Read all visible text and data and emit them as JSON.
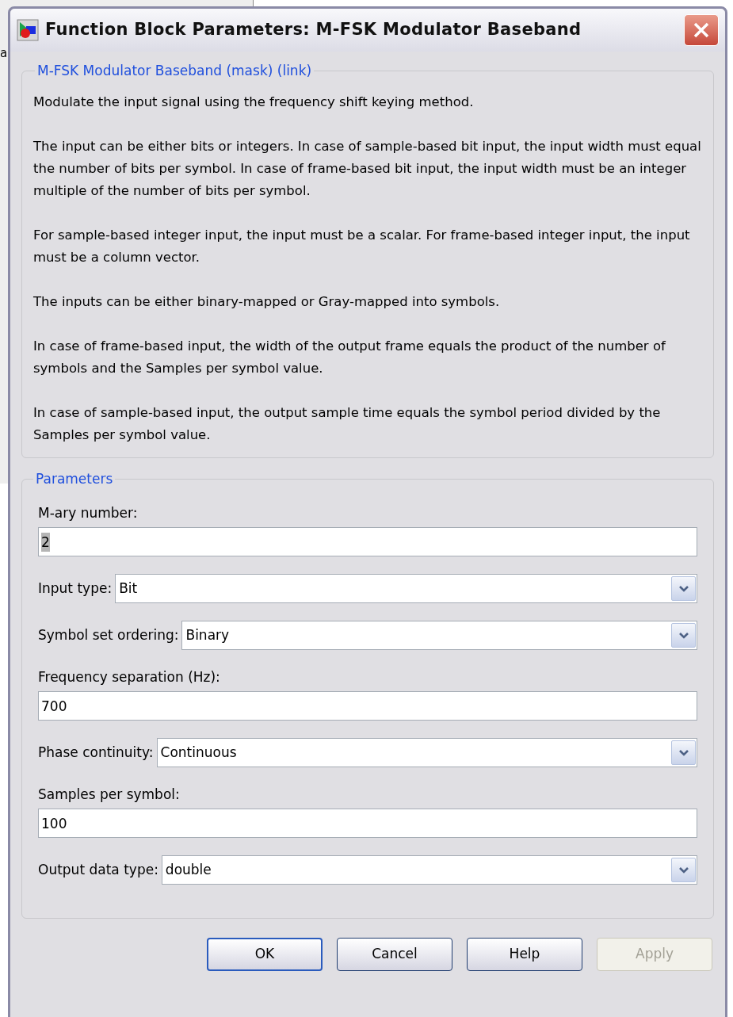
{
  "background_window": {
    "text": "a"
  },
  "window": {
    "title": "Function Block Parameters: M-FSK Modulator Baseband"
  },
  "description": {
    "legend": "M-FSK Modulator Baseband (mask) (link)",
    "paragraphs": [
      "Modulate the input signal using the frequency shift keying method.",
      "The input can be either bits or integers. In case of sample-based bit input, the input width must equal the number of bits per symbol. In case of frame-based bit input, the input width must be an integer multiple of the number of bits per symbol.",
      "For sample-based integer input, the input must be a scalar. For frame-based integer input, the input must be a column vector.",
      "The inputs can be either binary-mapped or Gray-mapped into symbols.",
      "In case of frame-based input, the width of the output frame equals the product of the number of symbols and the Samples per symbol value.",
      "In case of sample-based input, the output sample time equals the symbol period divided by the Samples per symbol value."
    ]
  },
  "parameters": {
    "legend": "Parameters",
    "items": [
      {
        "kind": "edit",
        "label": "M-ary number:",
        "value": "2",
        "text_selected": true
      },
      {
        "kind": "popup",
        "label": "Input type:",
        "value": "Bit"
      },
      {
        "kind": "popup",
        "label": "Symbol set ordering:",
        "value": "Binary"
      },
      {
        "kind": "edit",
        "label": "Frequency separation (Hz):",
        "value": "700",
        "text_selected": false
      },
      {
        "kind": "popup",
        "label": "Phase continuity:",
        "value": "Continuous"
      },
      {
        "kind": "edit",
        "label": "Samples per symbol:",
        "value": "100",
        "text_selected": false
      },
      {
        "kind": "popup",
        "label": "Output data type:",
        "value": "double"
      }
    ]
  },
  "buttons": [
    {
      "label": "OK",
      "disabled": false,
      "default": true
    },
    {
      "label": "Cancel",
      "disabled": false,
      "default": false
    },
    {
      "label": "Help",
      "disabled": false,
      "default": false
    },
    {
      "label": "Apply",
      "disabled": true,
      "default": false
    }
  ]
}
